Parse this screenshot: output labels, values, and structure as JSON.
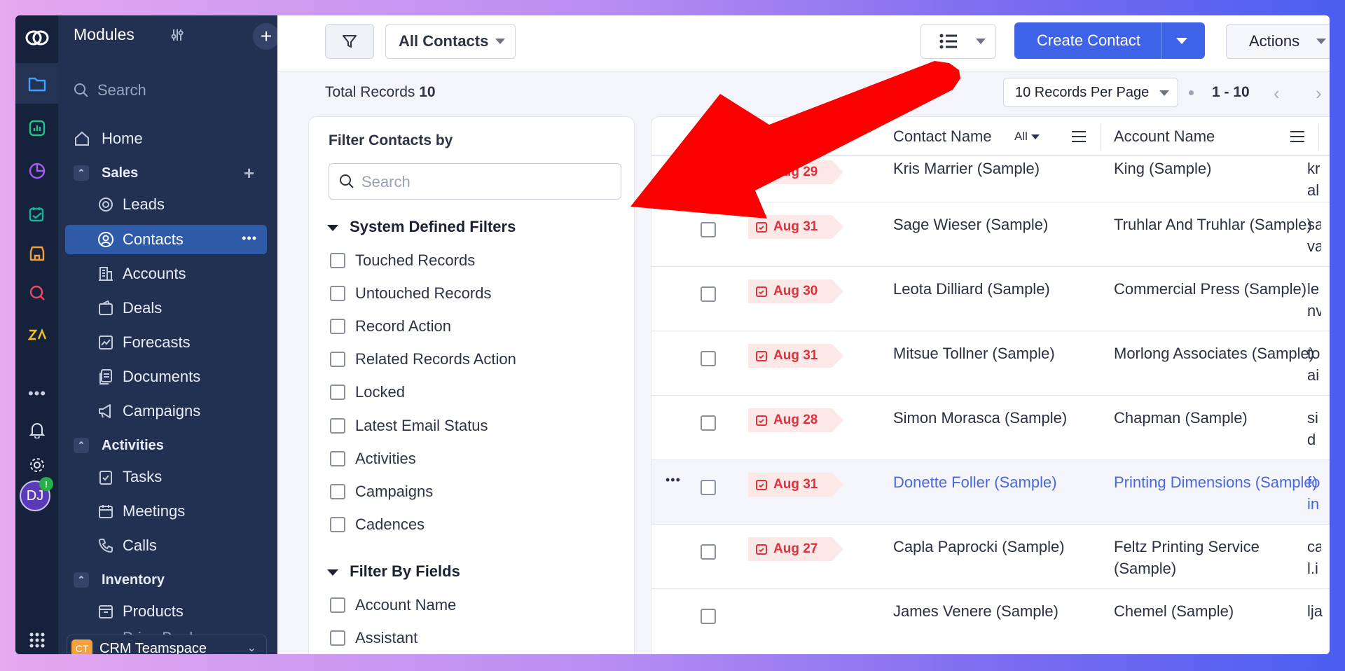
{
  "colors": {
    "accent": "#3f63e6",
    "due_red": "#e0303a",
    "link_blue": "#4a67e0",
    "arrow": "#fb0000"
  },
  "sidebar": {
    "title": "Modules",
    "search_placeholder": "Search",
    "home": "Home",
    "sales": "Sales",
    "leads": "Leads",
    "contacts": "Contacts",
    "accounts": "Accounts",
    "deals": "Deals",
    "forecasts": "Forecasts",
    "documents": "Documents",
    "campaigns": "Campaigns",
    "activities": "Activities",
    "tasks": "Tasks",
    "meetings": "Meetings",
    "calls": "Calls",
    "inventory": "Inventory",
    "products": "Products",
    "price_books": "Price Books",
    "teamspace_badge": "CT",
    "teamspace": "CRM Teamspace",
    "more_dots": "•••"
  },
  "rail": {
    "avatar": "DJ",
    "badge": "!"
  },
  "toolbar": {
    "view": "All Contacts",
    "create": "Create Contact",
    "actions": "Actions"
  },
  "records": {
    "label": "Total Records",
    "count": "10",
    "per_page": "10 Records Per Page",
    "range": "1 - 10"
  },
  "filter": {
    "title": "Filter Contacts by",
    "search_placeholder": "Search",
    "system_title": "System Defined Filters",
    "system": [
      "Touched Records",
      "Untouched Records",
      "Record Action",
      "Related Records Action",
      "Locked",
      "Latest Email Status",
      "Activities",
      "Campaigns",
      "Cadences"
    ],
    "fields_title": "Filter By Fields",
    "fields": [
      "Account Name",
      "Assistant"
    ]
  },
  "table": {
    "col_contact": "Contact Name",
    "col_contact_filter": "All",
    "col_account": "Account Name",
    "row_menu": "•••",
    "rows": [
      {
        "due": "Aug 29",
        "contact": "Kris Marrier (Sample)",
        "account": "King (Sample)",
        "email": "kr al"
      },
      {
        "due": "Aug 31",
        "contact": "Sage Wieser (Sample)",
        "account": "Truhlar And Truhlar (Sample)",
        "email": "sa va"
      },
      {
        "due": "Aug 30",
        "contact": "Leota Dilliard (Sample)",
        "account": "Commercial Press (Sample)",
        "email": "le nv"
      },
      {
        "due": "Aug 31",
        "contact": "Mitsue Tollner (Sample)",
        "account": "Morlong Associates (Sample)",
        "email": "to ai"
      },
      {
        "due": "Aug 28",
        "contact": "Simon Morasca (Sample)",
        "account": "Chapman (Sample)",
        "email": "si d"
      },
      {
        "due": "Aug 31",
        "contact": "Donette Foller (Sample)",
        "account": "Printing Dimensions (Sample)",
        "email": "fo in"
      },
      {
        "due": "Aug 27",
        "contact": "Capla Paprocki (Sample)",
        "account": "Feltz Printing Service (Sample)",
        "email": "ca l.i"
      },
      {
        "due": "",
        "contact": "James Venere (Sample)",
        "account": "Chemel (Sample)",
        "email": "lja"
      }
    ]
  }
}
